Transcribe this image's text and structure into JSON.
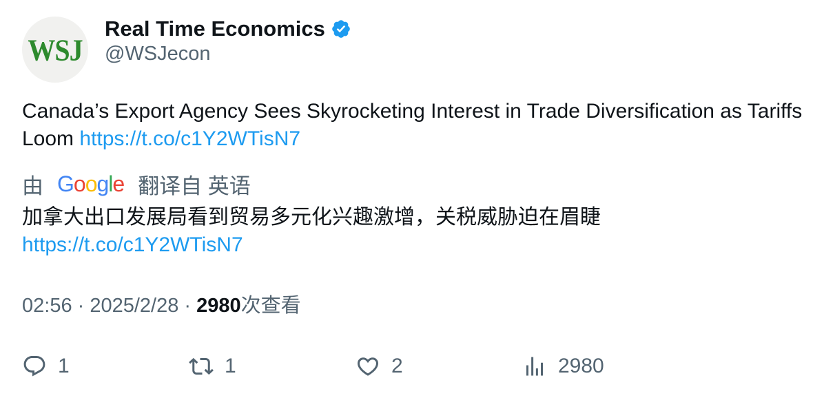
{
  "author": {
    "avatar_text": "WSJ",
    "display_name": "Real Time Economics",
    "verified_icon": "verified-badge-icon",
    "handle": "@WSJecon"
  },
  "tweet": {
    "text": "Canada’s Export Agency Sees Skyrocketing Interest in Trade Diversification as Tariffs Loom ",
    "link": "https://t.co/c1Y2WTisN7"
  },
  "translation": {
    "prefix": "由",
    "google_letters": [
      "G",
      "o",
      "o",
      "g",
      "l",
      "e"
    ],
    "suffix": "翻译自 英语",
    "text": "加拿大出口发展局看到贸易多元化兴趣激增，关税威胁迫在眉睫",
    "link": "https://t.co/c1Y2WTisN7"
  },
  "meta": {
    "time": "02:56",
    "separator": " · ",
    "date": "2025/2/28",
    "views_count": "2980",
    "views_label": "次查看"
  },
  "actions": {
    "reply": {
      "icon": "reply-icon",
      "count": "1"
    },
    "retweet": {
      "icon": "retweet-icon",
      "count": "1"
    },
    "like": {
      "icon": "heart-icon",
      "count": "2"
    },
    "views": {
      "icon": "analytics-icon",
      "count": "2980"
    }
  },
  "colors": {
    "link": "#1d9bf0",
    "verified": "#1d9bf0",
    "secondary_text": "#536471",
    "primary_text": "#0f1419",
    "avatar_logo": "#2d8a2d"
  }
}
